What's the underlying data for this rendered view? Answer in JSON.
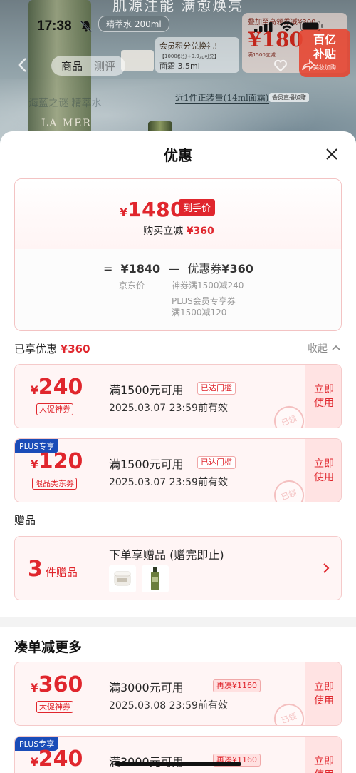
{
  "status": {
    "time": "17:38"
  },
  "background": {
    "headline": "肌源注能 满愈焕亮",
    "sub_pill": "精萃水 200ml",
    "bottle_label": "LA MER",
    "member_title": "会员积分兑换礼!",
    "member_line": "【1000积分+9.9元可兑】",
    "member_item": "面霜 3.5ml",
    "gift_line": "叠加至高领券减¥300",
    "gift_price": "¥180",
    "gift_note": "满1500立减",
    "subsidy_1": "百亿",
    "subsidy_2": "补贴",
    "subsidy_3": "美妆加购",
    "promo_strip": "近1件正装量(14ml面霜)",
    "live_pill": "会员直播加赠",
    "faded_text": "海蓝之谜 精萃水"
  },
  "nav": {
    "tabs": [
      "商品",
      "测评"
    ]
  },
  "sheet": {
    "title": "优惠",
    "final": {
      "yen": "¥",
      "price": "1480",
      "tag": "到手价"
    },
    "instant_cut": {
      "prefix": "购买立减 ",
      "amount": "¥360"
    },
    "formula": {
      "eq": "=",
      "jd_price": "¥1840",
      "minus": "—",
      "coupon_label": "优惠券",
      "coupon_amount": "¥360",
      "jd_label": "京东价",
      "line1": "神券满1500减240",
      "line2": "PLUS会员专享券",
      "line3": "满1500减120"
    }
  },
  "enjoyed": {
    "label": "已享优惠 ",
    "amount": "¥360",
    "collapse": "收起"
  },
  "coupons": [
    {
      "yen": "¥",
      "amount": "240",
      "kind": "大促神券",
      "cond": "满1500元可用",
      "badge": "已达门槛",
      "expire": "2025.03.07 23:59前有效",
      "action_1": "立即",
      "action_2": "使用",
      "stamp": "已领"
    },
    {
      "plus": "PLUS专享",
      "yen": "¥",
      "amount": "120",
      "kind": "限品类东券",
      "cond": "满1500元可用",
      "badge": "已达门槛",
      "expire": "2025.03.07 23:59前有效",
      "action_1": "立即",
      "action_2": "使用",
      "stamp": "已领"
    }
  ],
  "gifts": {
    "section": "赠品",
    "count": "3",
    "unit": "件赠品",
    "title": "下单享赠品 (赠完即止)"
  },
  "more": {
    "title": "凑单减更多",
    "coupons": [
      {
        "yen": "¥",
        "amount": "360",
        "kind": "大促神券",
        "cond": "满3000元可用",
        "badge": "再凑¥1160",
        "expire": "2025.03.08 23:59前有效",
        "action_1": "立即",
        "action_2": "使用",
        "stamp": "已领"
      },
      {
        "plus": "PLUS专享",
        "yen": "¥",
        "amount": "240",
        "cond": "满3000元可用",
        "badge": "再凑¥1160",
        "action_1": "立即",
        "action_2": "使用"
      }
    ]
  },
  "colors": {
    "accent": "#e0262d",
    "plus": "#1a4cb8",
    "coupon_bg": "#fff5f5"
  }
}
